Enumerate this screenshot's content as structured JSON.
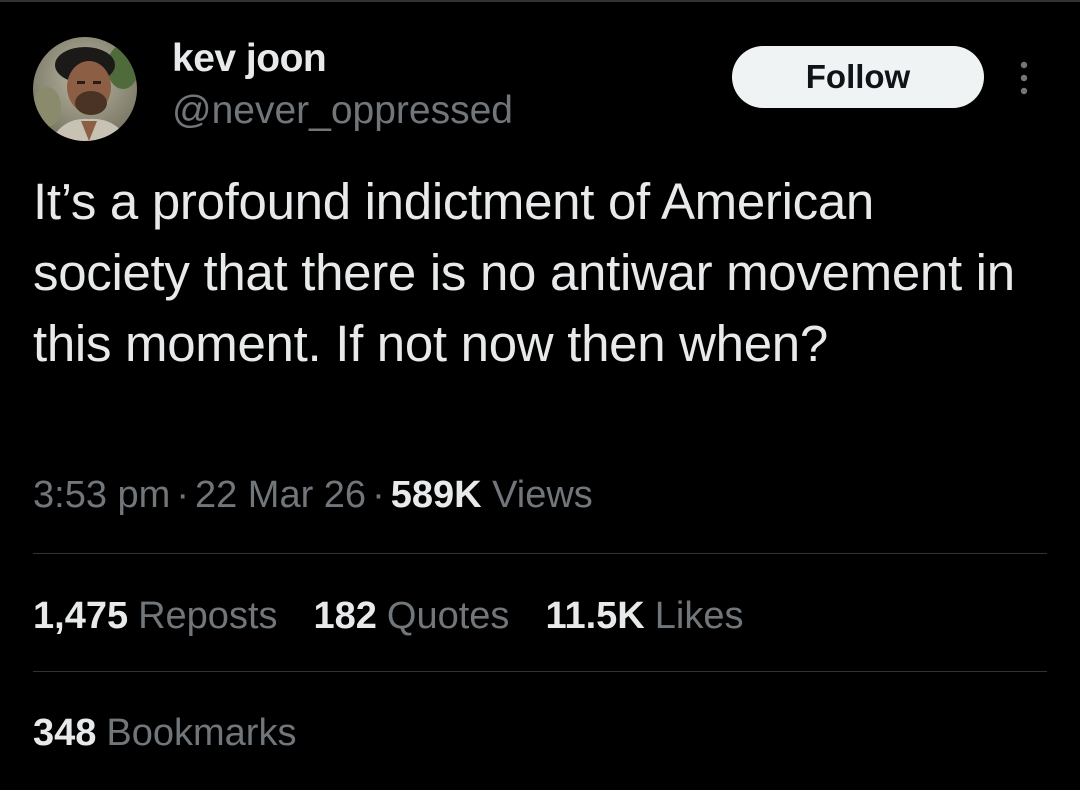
{
  "colors": {
    "background": "#000000",
    "primary_text": "#e7e9ea",
    "secondary_text": "#71767b",
    "divider": "#2f3336",
    "follow_button_bg": "#eff3f4",
    "follow_button_text": "#0f1419"
  },
  "author": {
    "display_name": "kev joon",
    "handle": "@never_oppressed",
    "avatar_icon": "profile-photo"
  },
  "header": {
    "follow_label": "Follow",
    "more_icon": "more-vertical-icon"
  },
  "tweet": {
    "text": "It’s a profound indictment of American society that there is no antiwar movement in this moment. If not now then when?",
    "time": "3:53 pm",
    "separator": "·",
    "date": "22 Mar 26",
    "views_count": "589K",
    "views_label": "Views"
  },
  "stats": {
    "reposts_count": "1,475",
    "reposts_label": "Reposts",
    "quotes_count": "182",
    "quotes_label": "Quotes",
    "likes_count": "11.5K",
    "likes_label": "Likes",
    "bookmarks_count": "348",
    "bookmarks_label": "Bookmarks"
  }
}
